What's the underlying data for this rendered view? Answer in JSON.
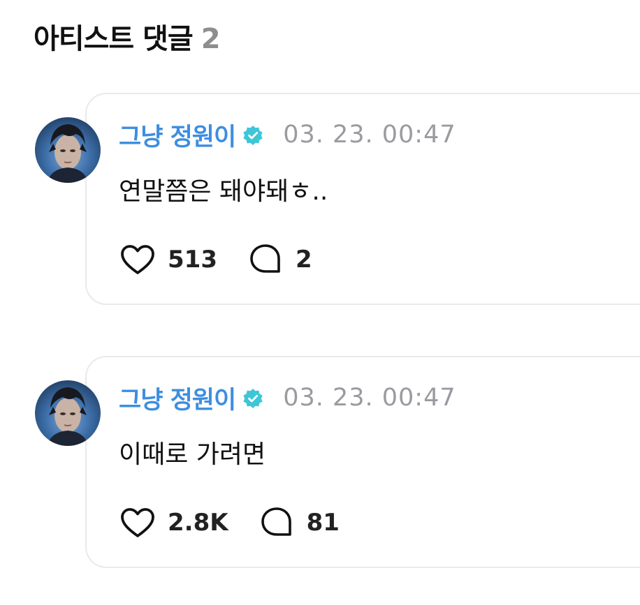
{
  "header": {
    "title": "아티스트 댓글",
    "count": "2"
  },
  "comments": [
    {
      "author": "그냥 정원이",
      "timestamp": "03. 23. 00:47",
      "text": "연말쯤은 돼야돼ㅎ..",
      "likes": "513",
      "replies": "2"
    },
    {
      "author": "그냥 정원이",
      "timestamp": "03. 23. 00:47",
      "text": "이때로 가려면",
      "likes": "2.8K",
      "replies": "81"
    }
  ],
  "icons": {
    "verified": "verified-badge-icon",
    "like": "heart-icon",
    "reply": "speech-bubble-icon"
  },
  "colors": {
    "author": "#3d8ee0",
    "verified_badge": "#3ec6d8",
    "timestamp": "#9a9aa0",
    "count": "#8e8e8e",
    "card_border": "#e9e9ee"
  }
}
